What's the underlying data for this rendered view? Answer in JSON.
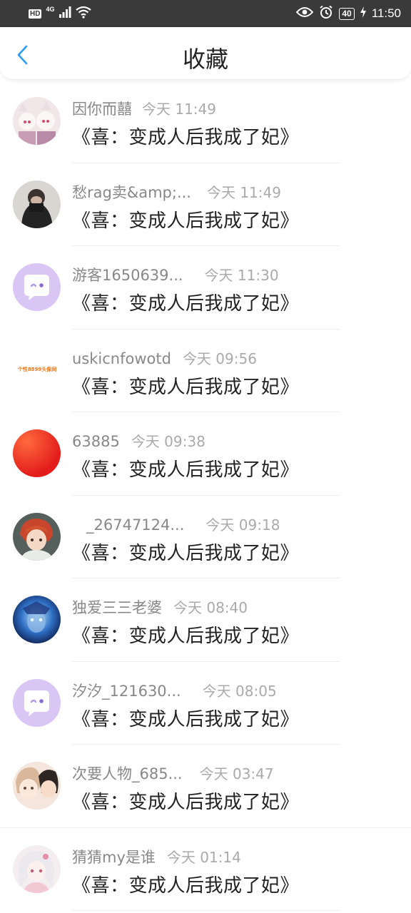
{
  "status_bar": {
    "hd": "HD",
    "network": "4G",
    "battery": "40",
    "time": "11:50"
  },
  "header": {
    "title": "收藏"
  },
  "items": [
    {
      "user": "因你而囍",
      "time": "今天 11:49",
      "title": "《喜：变成人后我成了妃》",
      "avatar": "avatar-anime-group"
    },
    {
      "user": "愁rag卖&amp;...",
      "time": "今天 11:49",
      "title": "《喜：变成人后我成了妃》",
      "avatar": "avatar-dark-figure"
    },
    {
      "user": "游客1650639...",
      "time": "今天 11:30",
      "title": "《喜：变成人后我成了妃》",
      "avatar": "avatar-default-chat"
    },
    {
      "user": "uskicnfowotd",
      "time": "今天 09:56",
      "title": "《喜：变成人后我成了妃》",
      "avatar": "avatar-text-logo",
      "avatar_text": "个性8899头像网"
    },
    {
      "user": "63885",
      "time": "今天 09:38",
      "title": "《喜：变成人后我成了妃》",
      "avatar": "avatar-red-circle"
    },
    {
      "user": "_26747124...",
      "time": "今天 09:18",
      "title": "《喜：变成人后我成了妃》",
      "avatar": "avatar-anime-redhair"
    },
    {
      "user": "独爱三三老婆",
      "time": "今天 08:40",
      "title": "《喜：变成人后我成了妃》",
      "avatar": "avatar-blue-character"
    },
    {
      "user": "汐汐_121630...",
      "time": "今天 08:05",
      "title": "《喜：变成人后我成了妃》",
      "avatar": "avatar-default-chat"
    },
    {
      "user": "次要人物_685...",
      "time": "今天 03:47",
      "title": "《喜：变成人后我成了妃》",
      "avatar": "avatar-anime-couple"
    },
    {
      "user": "猜猜my是谁",
      "time": "今天 01:14",
      "title": "《喜：变成人后我成了妃》",
      "avatar": "avatar-anime-white"
    }
  ],
  "colors": {
    "accent": "#2b9df4",
    "default_avatar_bg": "#d9c6f5",
    "status_bar_bg": "#3a3a3a"
  }
}
